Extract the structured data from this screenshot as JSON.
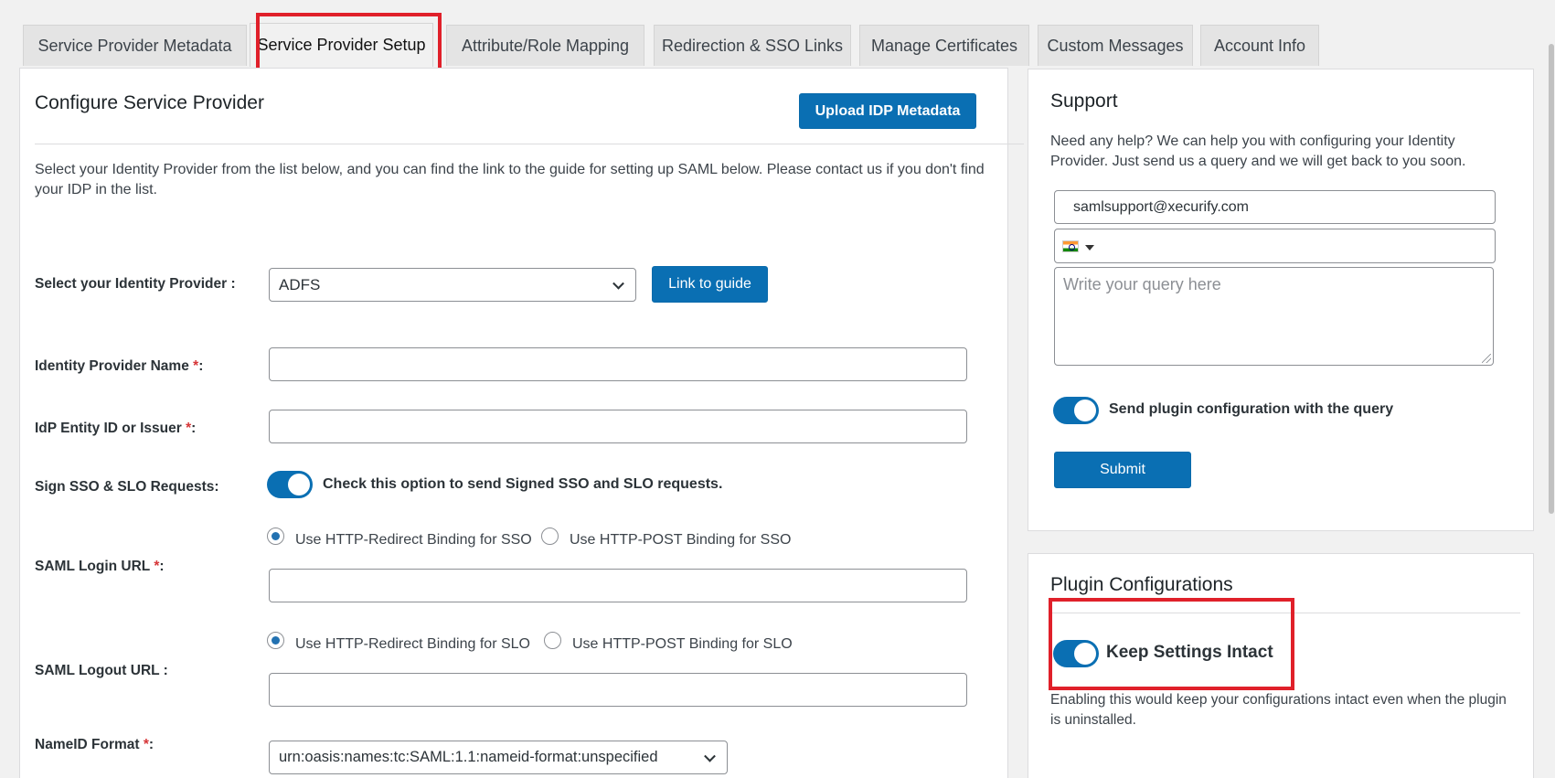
{
  "tabs": [
    {
      "label": "Service Provider Metadata"
    },
    {
      "label": "Service Provider Setup"
    },
    {
      "label": "Attribute/Role Mapping"
    },
    {
      "label": "Redirection & SSO Links"
    },
    {
      "label": "Manage Certificates"
    },
    {
      "label": "Custom Messages"
    },
    {
      "label": "Account Info"
    }
  ],
  "main": {
    "title": "Configure Service Provider",
    "upload_button": "Upload IDP Metadata",
    "description": "Select your Identity Provider from the list below, and you can find the link to the guide for setting up SAML below. Please contact us if you don't find your IDP in the list.",
    "idp_select": {
      "label": "Select your Identity Provider :",
      "value": "ADFS"
    },
    "link_guide_button": "Link to guide",
    "idp_name": {
      "label": "Identity Provider Name ",
      "required": "*",
      "colon": ":",
      "value": ""
    },
    "entity_id": {
      "label": "IdP Entity ID or Issuer ",
      "required": "*",
      "colon": ":",
      "value": ""
    },
    "sign_requests": {
      "label": "Sign SSO & SLO Requests:",
      "toggle_text": "Check this option to send Signed SSO and SLO requests.",
      "enabled": true
    },
    "login_url": {
      "label": "SAML Login URL ",
      "required": "*",
      "colon": ":",
      "option_redirect": "Use HTTP-Redirect Binding for SSO",
      "option_post": "Use HTTP-POST Binding for SSO",
      "selected": "redirect",
      "value": ""
    },
    "logout_url": {
      "label": "SAML Logout URL :",
      "option_redirect": "Use HTTP-Redirect Binding for SLO",
      "option_post": "Use HTTP-POST Binding for SLO",
      "selected": "redirect",
      "value": ""
    },
    "nameid": {
      "label": "NameID Format ",
      "required": "*",
      "colon": ":",
      "value": "urn:oasis:names:tc:SAML:1.1:nameid-format:unspecified"
    }
  },
  "support": {
    "title": "Support",
    "description": "Need any help? We can help you with configuring your Identity Provider. Just send us a query and we will get back to you soon.",
    "email": "samlsupport@xecurify.com",
    "phone_value": "",
    "query_placeholder": "Write your query here",
    "send_config_label": "Send plugin configuration with the query",
    "send_config_enabled": true,
    "submit_button": "Submit"
  },
  "plugin_config": {
    "title": "Plugin Configurations",
    "keep_settings_label": "Keep Settings Intact",
    "keep_settings_enabled": true,
    "keep_settings_desc": "Enabling this would keep your configurations intact even when the plugin is uninstalled."
  },
  "colors": {
    "accent": "#0a6fb3",
    "highlight": "#e0202a",
    "required": "#d63638"
  }
}
